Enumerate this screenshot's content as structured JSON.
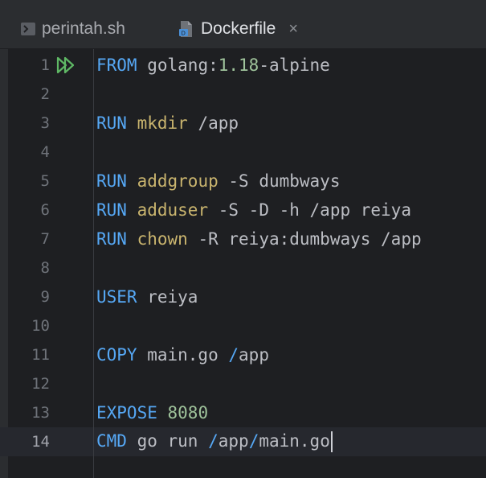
{
  "tabs": [
    {
      "label": "perintah.sh",
      "icon": "terminal-script-icon",
      "active": false
    },
    {
      "label": "Dockerfile",
      "icon": "docker-file-icon",
      "active": true,
      "close": "×"
    }
  ],
  "editor": {
    "current_line": 14,
    "line_numbers": [
      "1",
      "2",
      "3",
      "4",
      "5",
      "6",
      "7",
      "8",
      "9",
      "10",
      "11",
      "12",
      "13",
      "14"
    ],
    "code": {
      "l1": {
        "kw": "FROM",
        "image": "golang:",
        "version": "1.18",
        "suffix": "-alpine"
      },
      "l3": {
        "kw": "RUN",
        "cmd": "mkdir",
        "args": " /app"
      },
      "l5": {
        "kw": "RUN",
        "cmd": "addgroup",
        "args": " -S dumbways"
      },
      "l6": {
        "kw": "RUN",
        "cmd": "adduser",
        "args": " -S -D -h /app reiya"
      },
      "l7": {
        "kw": "RUN",
        "cmd": "chown",
        "args": " -R reiya:dumbways /app"
      },
      "l9": {
        "kw": "USER",
        "args": " reiya"
      },
      "l11": {
        "kw": "COPY",
        "src": " main.go ",
        "slash": "/",
        "dest": "app"
      },
      "l13": {
        "kw": "EXPOSE",
        "port": "8080"
      },
      "l14": {
        "kw": "CMD",
        "args": " go run ",
        "slash1": "/",
        "p1": "app",
        "slash2": "/",
        "p2": "main.go"
      }
    }
  },
  "colors": {
    "background": "#1e1f22",
    "keyword": "#56a8f5",
    "command": "#c9b46e",
    "number": "#9fc39b",
    "text": "#bcbec4",
    "run_gutter_icon": "#5fb865"
  }
}
